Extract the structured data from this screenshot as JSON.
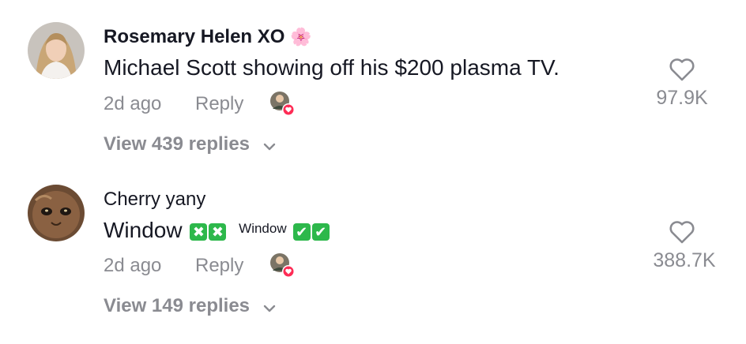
{
  "comments": [
    {
      "username": "Rosemary Helen XO",
      "username_emoji": "🌸",
      "text": "Michael Scott showing off his $200 plasma TV.",
      "time": "2d ago",
      "reply_label": "Reply",
      "view_replies": "View 439 replies",
      "likes": "97.9K"
    },
    {
      "username": "Cherry yany",
      "text_main": "Window",
      "emoji_cross": "✖",
      "text_small": "Window",
      "emoji_check": "✔",
      "time": "2d ago",
      "reply_label": "Reply",
      "view_replies": "View 149 replies",
      "likes": "388.7K"
    }
  ],
  "colors": {
    "primary_text": "#161823",
    "secondary_text": "#8a8b91",
    "emoji_green": "#2db84b",
    "creator_heart": "#fe2c55"
  },
  "icons": [
    "heart-outline-icon",
    "chevron-down-icon",
    "creator-liked-badge"
  ]
}
